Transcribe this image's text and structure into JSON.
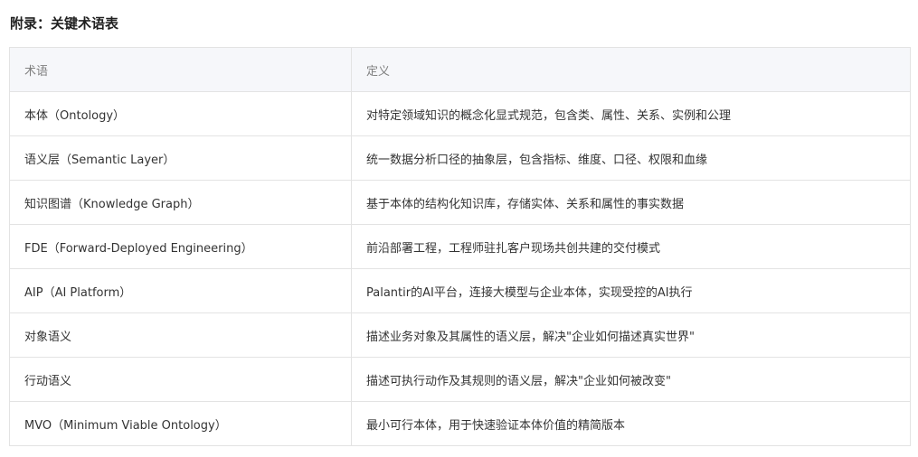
{
  "section_title": "附录：关键术语表",
  "table": {
    "headers": [
      "术语",
      "定义"
    ],
    "rows": [
      {
        "term": "本体（Ontology）",
        "definition": "对特定领域知识的概念化显式规范，包含类、属性、关系、实例和公理"
      },
      {
        "term": "语义层（Semantic Layer）",
        "definition": "统一数据分析口径的抽象层，包含指标、维度、口径、权限和血缘"
      },
      {
        "term": "知识图谱（Knowledge Graph）",
        "definition": "基于本体的结构化知识库，存储实体、关系和属性的事实数据"
      },
      {
        "term": "FDE（Forward-Deployed Engineering）",
        "definition": "前沿部署工程，工程师驻扎客户现场共创共建的交付模式"
      },
      {
        "term": "AIP（AI Platform）",
        "definition": "Palantir的AI平台，连接大模型与企业本体，实现受控的AI执行"
      },
      {
        "term": "对象语义",
        "definition": "描述业务对象及其属性的语义层，解决\"企业如何描述真实世界\""
      },
      {
        "term": "行动语义",
        "definition": "描述可执行动作及其规则的语义层，解决\"企业如何被改变\""
      },
      {
        "term": "MVO（Minimum Viable Ontology）",
        "definition": "最小可行本体，用于快速验证本体价值的精简版本"
      }
    ]
  }
}
